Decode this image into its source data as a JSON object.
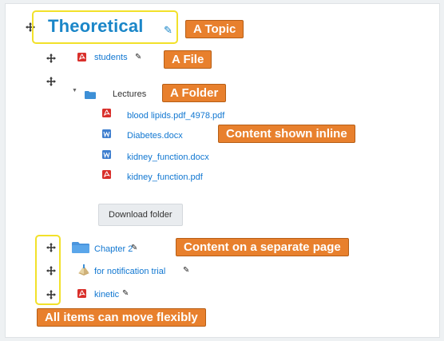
{
  "topic": {
    "title": "Theoretical"
  },
  "items": {
    "students": "students",
    "lectures": "Lectures",
    "files": [
      "blood lipids.pdf_4978.pdf",
      "Diabetes.docx",
      "kidney_function.docx",
      "kidney_function.pdf"
    ],
    "download_button": "Download folder",
    "chapter2": "Chapter 2",
    "notification": "for notification trial",
    "kinetic": "kinetic"
  },
  "callouts": {
    "topic": "A Topic",
    "file": "A File",
    "folder": "A Folder",
    "inline": "Content shown inline",
    "separate": "Content on a separate page",
    "move": "All items can move flexibly"
  },
  "colors": {
    "callout": "#e8802d",
    "highlight": "#f2e12a",
    "link": "#1177d1",
    "topic": "#1a86c8"
  },
  "icons": {
    "move": "move-arrows-icon",
    "pdf": "pdf-file-icon",
    "docx": "word-document-icon",
    "folder": "folder-icon",
    "edit": "pencil-icon"
  }
}
